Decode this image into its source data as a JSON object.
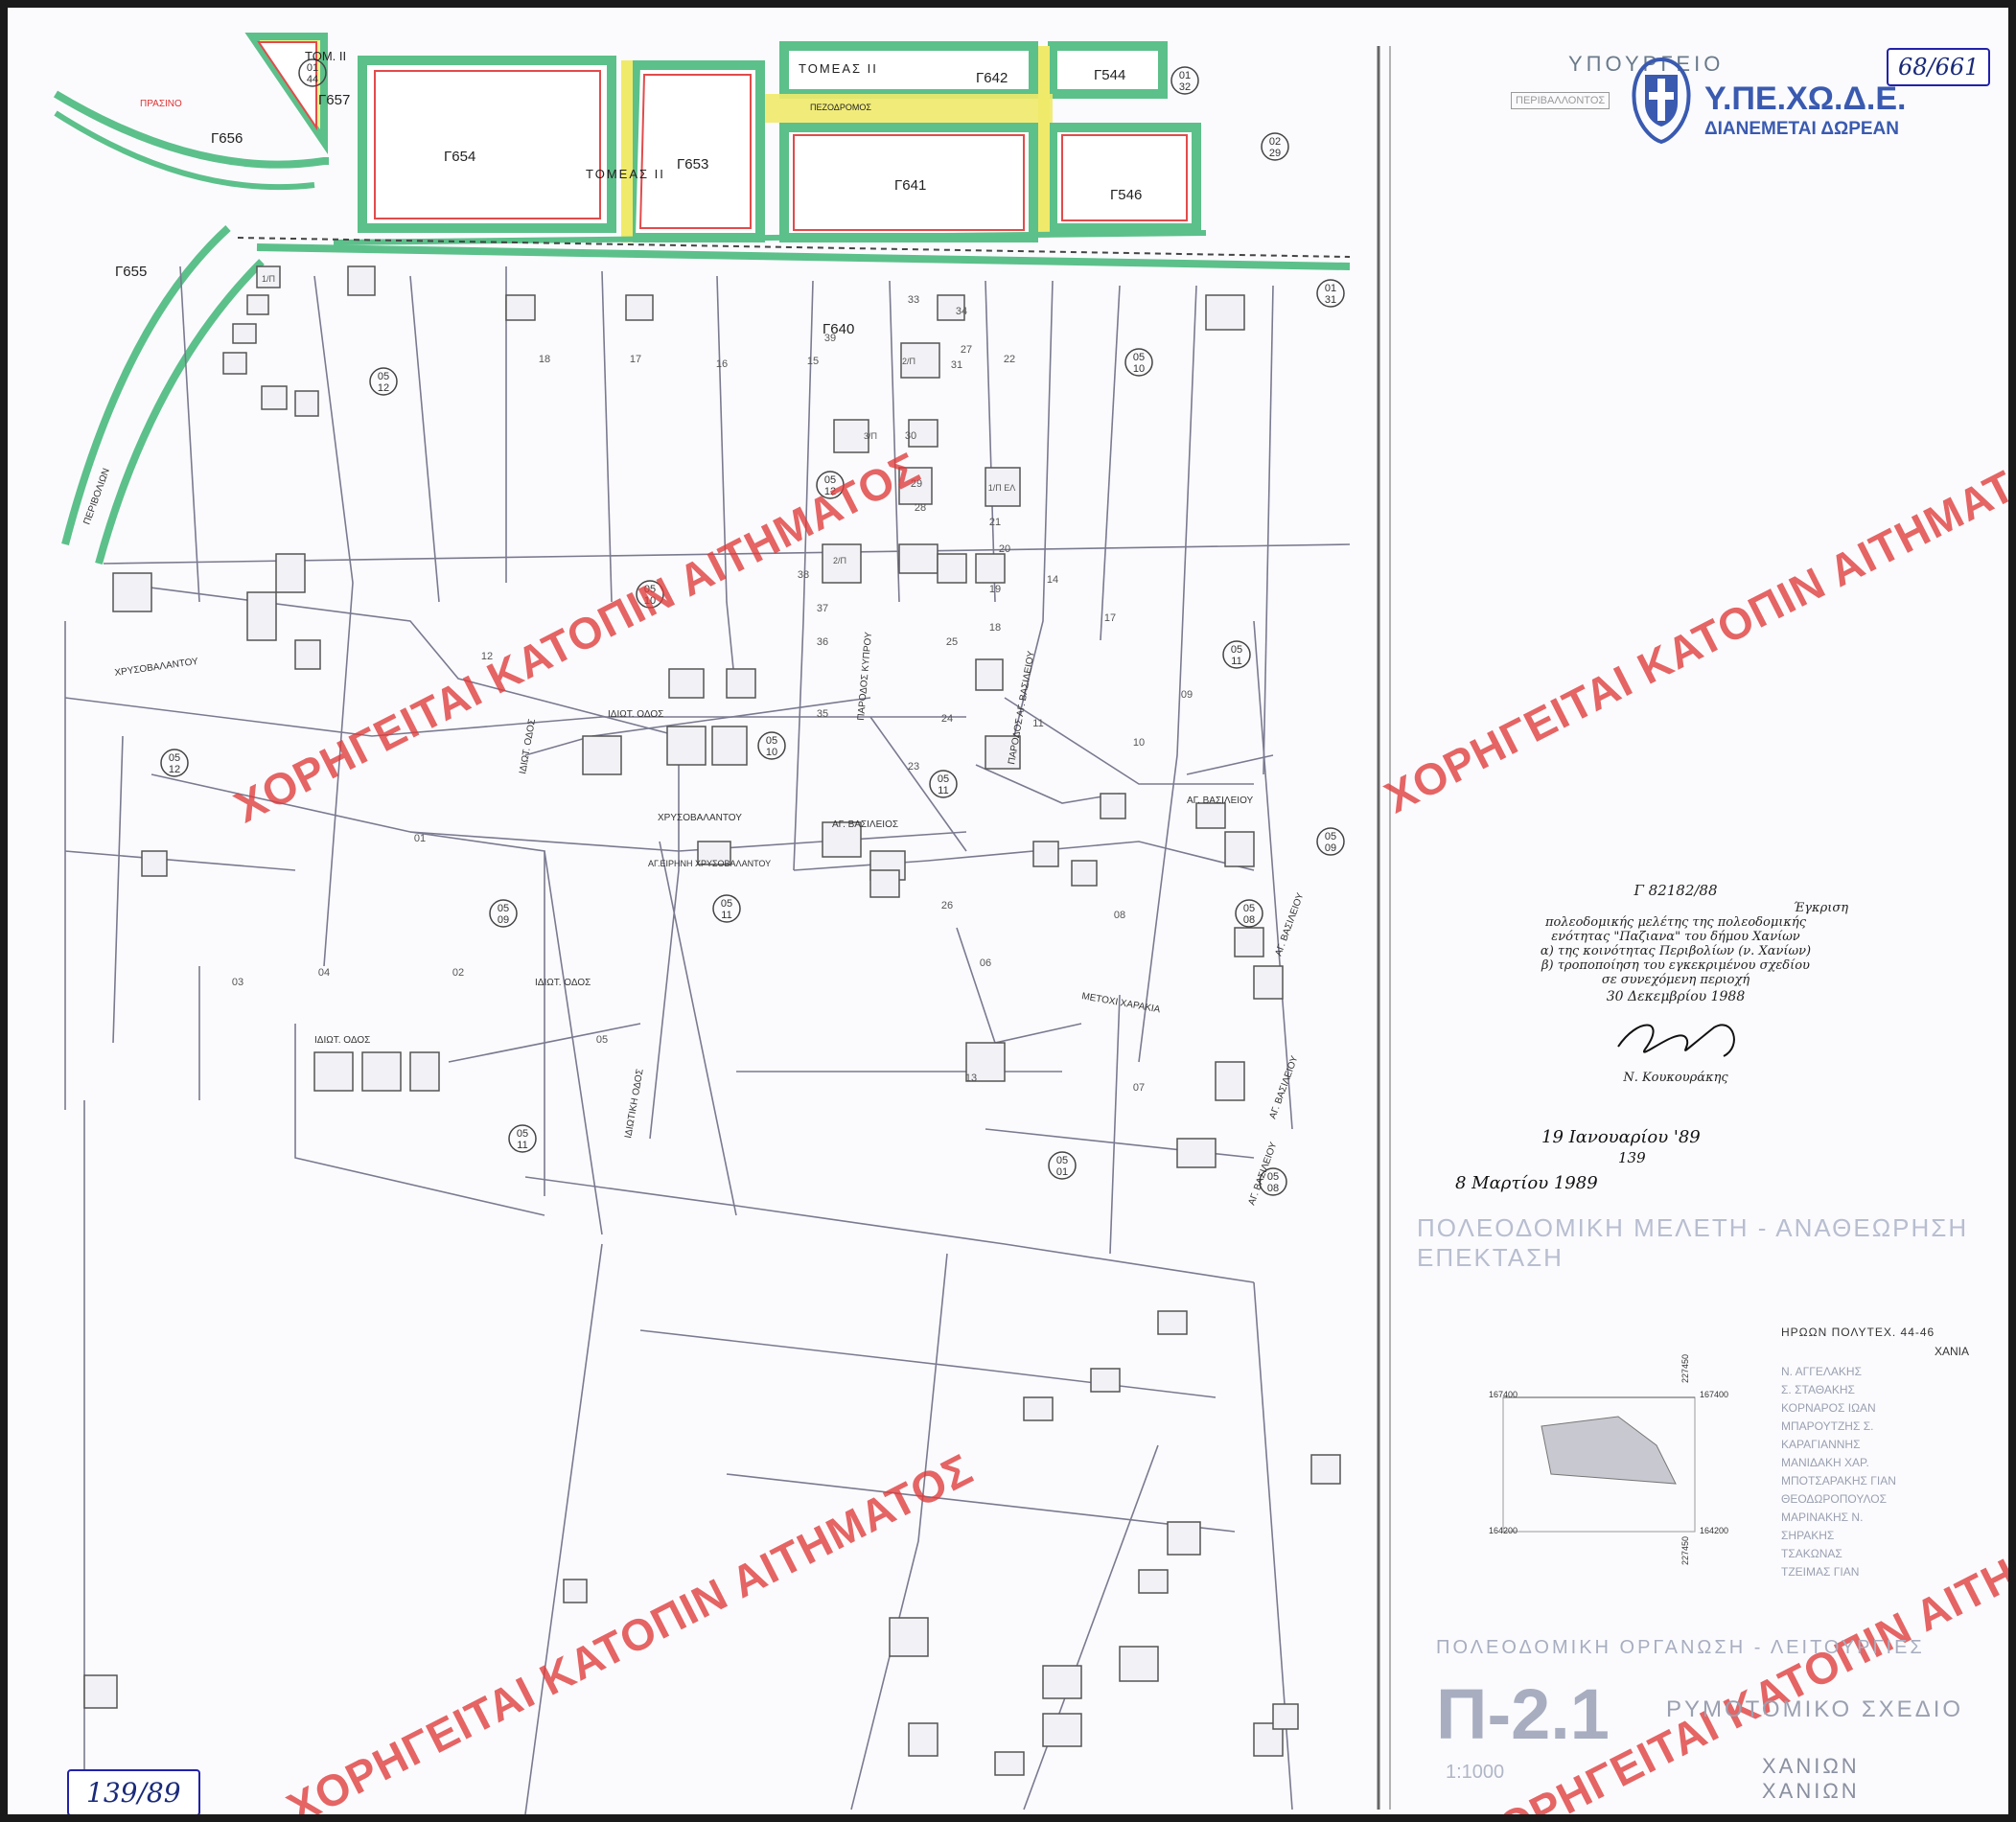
{
  "watermark": "ΧΟΡΗΓΕΙΤΑΙ ΚΑΤΟΠΙΝ ΑΙΤΗΜΑΤΟΣ",
  "stamp": {
    "ministry": "ΥΠΟΥΡΓΕΙΟ",
    "org": "Υ.ΠΕ.ΧΩ.Δ.Ε.",
    "free": "ΔΙΑΝΕΜΕΤΑΙ ΔΩΡΕΑΝ",
    "emblem": "greek-coat-of-arms-icon",
    "env_label": "ΠΕΡΙΒΑΛΛΟΝΤΟΣ"
  },
  "sheet_number": "68/661",
  "decision_number": "139/89",
  "approval": {
    "ref": "Γ 82182/88",
    "lines": [
      "Έγκριση",
      "πολεοδομικής μελέτης της πολεοδομικής",
      "ενότητας \"Παζιανα\" του δήμου Χανίων",
      "α) της κοινότητας Περιβολίων (ν. Χανίων)",
      "β) τροποποίηση του εγκεκριμένου σχεδίου",
      "σε συνεχόμενη περιοχή",
      "30 Δεκεμβρίου 1988"
    ],
    "signer": "Ν. Κουκουράκης"
  },
  "publication": {
    "fek_date": "19 Ιανουαρίου '89",
    "fek_number": "139",
    "issue_date": "8 Μαρτίου 1989"
  },
  "title_block": {
    "study_title": "ΠΟΛΕΟΔΟΜΙΚΗ ΜΕΛΕΤΗ - ΑΝΑΘΕΩΡΗΣΗ ΕΠΕΚΤΑΣΗ",
    "address": "ΗΡΩΩΝ ΠΟΛΥΤΕΧ. 44-46",
    "city": "ΧΑΝΙΑ",
    "team": [
      "Ν. ΑΓΓΕΛΑΚΗΣ",
      "Σ. ΣΤΑΘΑΚΗΣ",
      "ΚΟΡΝΑΡΟΣ ΙΩΑΝ",
      "ΜΠΑΡΟΥΤΖΗΣ Σ.",
      "ΚΑΡΑΓΙΑΝΝΗΣ",
      "ΜΑΝΙΔΑΚΗ ΧΑΡ.",
      "ΜΠΟΤΣΑΡΑΚΗΣ ΓΙΑΝ",
      "ΘΕΟΔΩΡΟΠΟΥΛΟΣ",
      "ΜΑΡΙΝΑΚΗΣ Ν.",
      "ΣΗΡΑΚΗΣ",
      "ΤΣΑΚΩΝΑΣ",
      "ΤΖΕΙΜΑΣ ΓΙΑΝ"
    ],
    "organization_label": "ΠΟΛΕΟΔΟΜΙΚΗ ΟΡΓΑΝΩΣΗ - ΛΕΙΤΟΥΡΓΙΕΣ",
    "plan_code": "Π-2.1",
    "plan_title": "ΡΥΜΟΤΟΜΙΚΟ ΣΧΕΔΙΟ",
    "scale": "1:1000",
    "municipality": "ΧΑΝΙΩΝ",
    "municipality2": "ΧΑΝΙΩΝ",
    "coords": {
      "x1": "167400",
      "x2": "167400",
      "y1": "164200",
      "y2": "164200",
      "c1": "227450",
      "c2": "227450"
    }
  },
  "map": {
    "blocks": [
      "Γ657",
      "Γ656",
      "Γ655",
      "Γ654",
      "Γ653",
      "Γ642",
      "Γ544",
      "Γ641",
      "Γ546",
      "Γ640"
    ],
    "sector_labels": [
      "ΤΟΜ. ΙΙ",
      "ΤΟΜΕΑΣ ΙΙ",
      "ΤΟΜΕΑΣ ΙΙ"
    ],
    "pedestrian": "ΠΕΖΟΔΡΟΜΟΣ",
    "green_label": "ΠΡΑΣΙΝΟ",
    "street_labels": [
      "ΧΡΥΣΟΒΑΛΑΝΤΟΥ",
      "ΙΔΙΩΤ. ΟΔΟΣ",
      "ΙΔΙΩΤ. ΟΔΟΣ",
      "ΧΡΥΣΟΒΑΛΑΝΤΟΥ",
      "ΑΓ. ΒΑΣΙΛΕΙΟΣ",
      "ΑΓ. ΒΑΣΙΛΕΙΟΥ",
      "ΜΕΤΟΧΙ ΧΑΡΑΚΙΑ",
      "ΑΓ. ΒΑΣΙΛΕΙΟΥ",
      "ΠΑΡΟΔΟΣ ΚΥΠΡΟΥ",
      "ΠΑΡΟΔΟΣ ΑΓ. ΒΑΣΙΛΕΙΟΥ",
      "ΙΔΙΩΤ. ΟΔΟΣ",
      "ΙΔΙΩΤΙΚΗ ΟΔΟΣ",
      "ΙΔΙΩΤ. ΟΔΟΣ",
      "ΠΕΡΙΒΟΛΙΩΝ",
      "ΑΓ. ΒΑΣΙΛΕΙΟΥ",
      "ΑΓ. ΒΑΣΙΛΕΙΟΥ"
    ],
    "church": "ΑΓ.ΕΙΡΗΝΗ ΧΡΥΣΟΒΑΛΑΝΤΟΥ",
    "zone_codes": [
      "05 12",
      "05 10",
      "05 12",
      "05 10",
      "05 11",
      "05 12",
      "05 10",
      "05 11",
      "05 09",
      "05 08",
      "05 09",
      "05 11",
      "05 11",
      "05 01",
      "05 08",
      "01 31",
      "01 44",
      "01 32",
      "02 29"
    ],
    "parcel_numbers": [
      "18",
      "17",
      "16",
      "15",
      "33",
      "34",
      "22",
      "31",
      "39",
      "30",
      "29",
      "28",
      "21",
      "20",
      "19",
      "18",
      "17",
      "38",
      "37",
      "36",
      "35",
      "25",
      "24",
      "23",
      "14",
      "13",
      "11",
      "10",
      "09",
      "08",
      "07",
      "06",
      "05",
      "04",
      "03",
      "02",
      "01",
      "12",
      "26",
      "27"
    ],
    "building_marks": [
      "1/Π",
      "2/Π",
      "3/Π",
      "1/Π ΕΛ",
      "2/Π"
    ]
  }
}
